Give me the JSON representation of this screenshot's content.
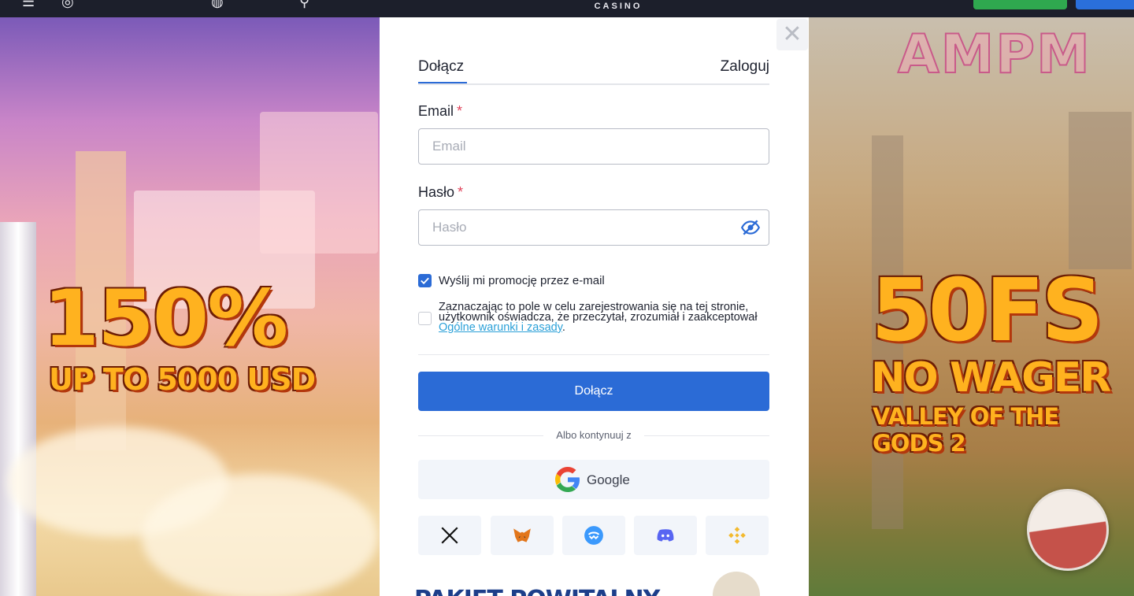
{
  "topbar": {
    "brand": "CASINO"
  },
  "background": {
    "left_promo_big": "150%",
    "left_promo_sub": "UP TO 5000 USD",
    "right_logo": "AMPM",
    "right_promo_big": "50FS",
    "right_promo_sub1": "NO WAGER",
    "right_promo_sub2": "VALLEY OF THE GODS 2"
  },
  "modal": {
    "tabs": {
      "join": "Dołącz",
      "login": "Zaloguj"
    },
    "email": {
      "label": "Email",
      "required": "*",
      "placeholder": "Email"
    },
    "password": {
      "label": "Hasło",
      "required": "*",
      "placeholder": "Hasło"
    },
    "promo_checkbox": {
      "checked": true,
      "label": "Wyślij mi promocję przez e-mail"
    },
    "terms_checkbox": {
      "checked": false,
      "text": "Zaznaczając to pole w celu zarejestrowania się na tej stronie, użytkownik oświadcza, że przeczytał, zrozumiał i zaakceptował ",
      "link": "Ogólne warunki i zasady",
      "suffix": "."
    },
    "submit_label": "Dołącz",
    "or_text": "Albo kontynuuj z",
    "google_label": "Google",
    "socials": [
      "x-icon",
      "metamask-icon",
      "walletconnect-icon",
      "discord-icon",
      "binance-icon"
    ],
    "bottom_banner": "PAKIET POWITALNY"
  },
  "colors": {
    "primary": "#2b6bd6",
    "link": "#2aa0d8",
    "required": "#e0425a",
    "green": "#2fa84f"
  }
}
